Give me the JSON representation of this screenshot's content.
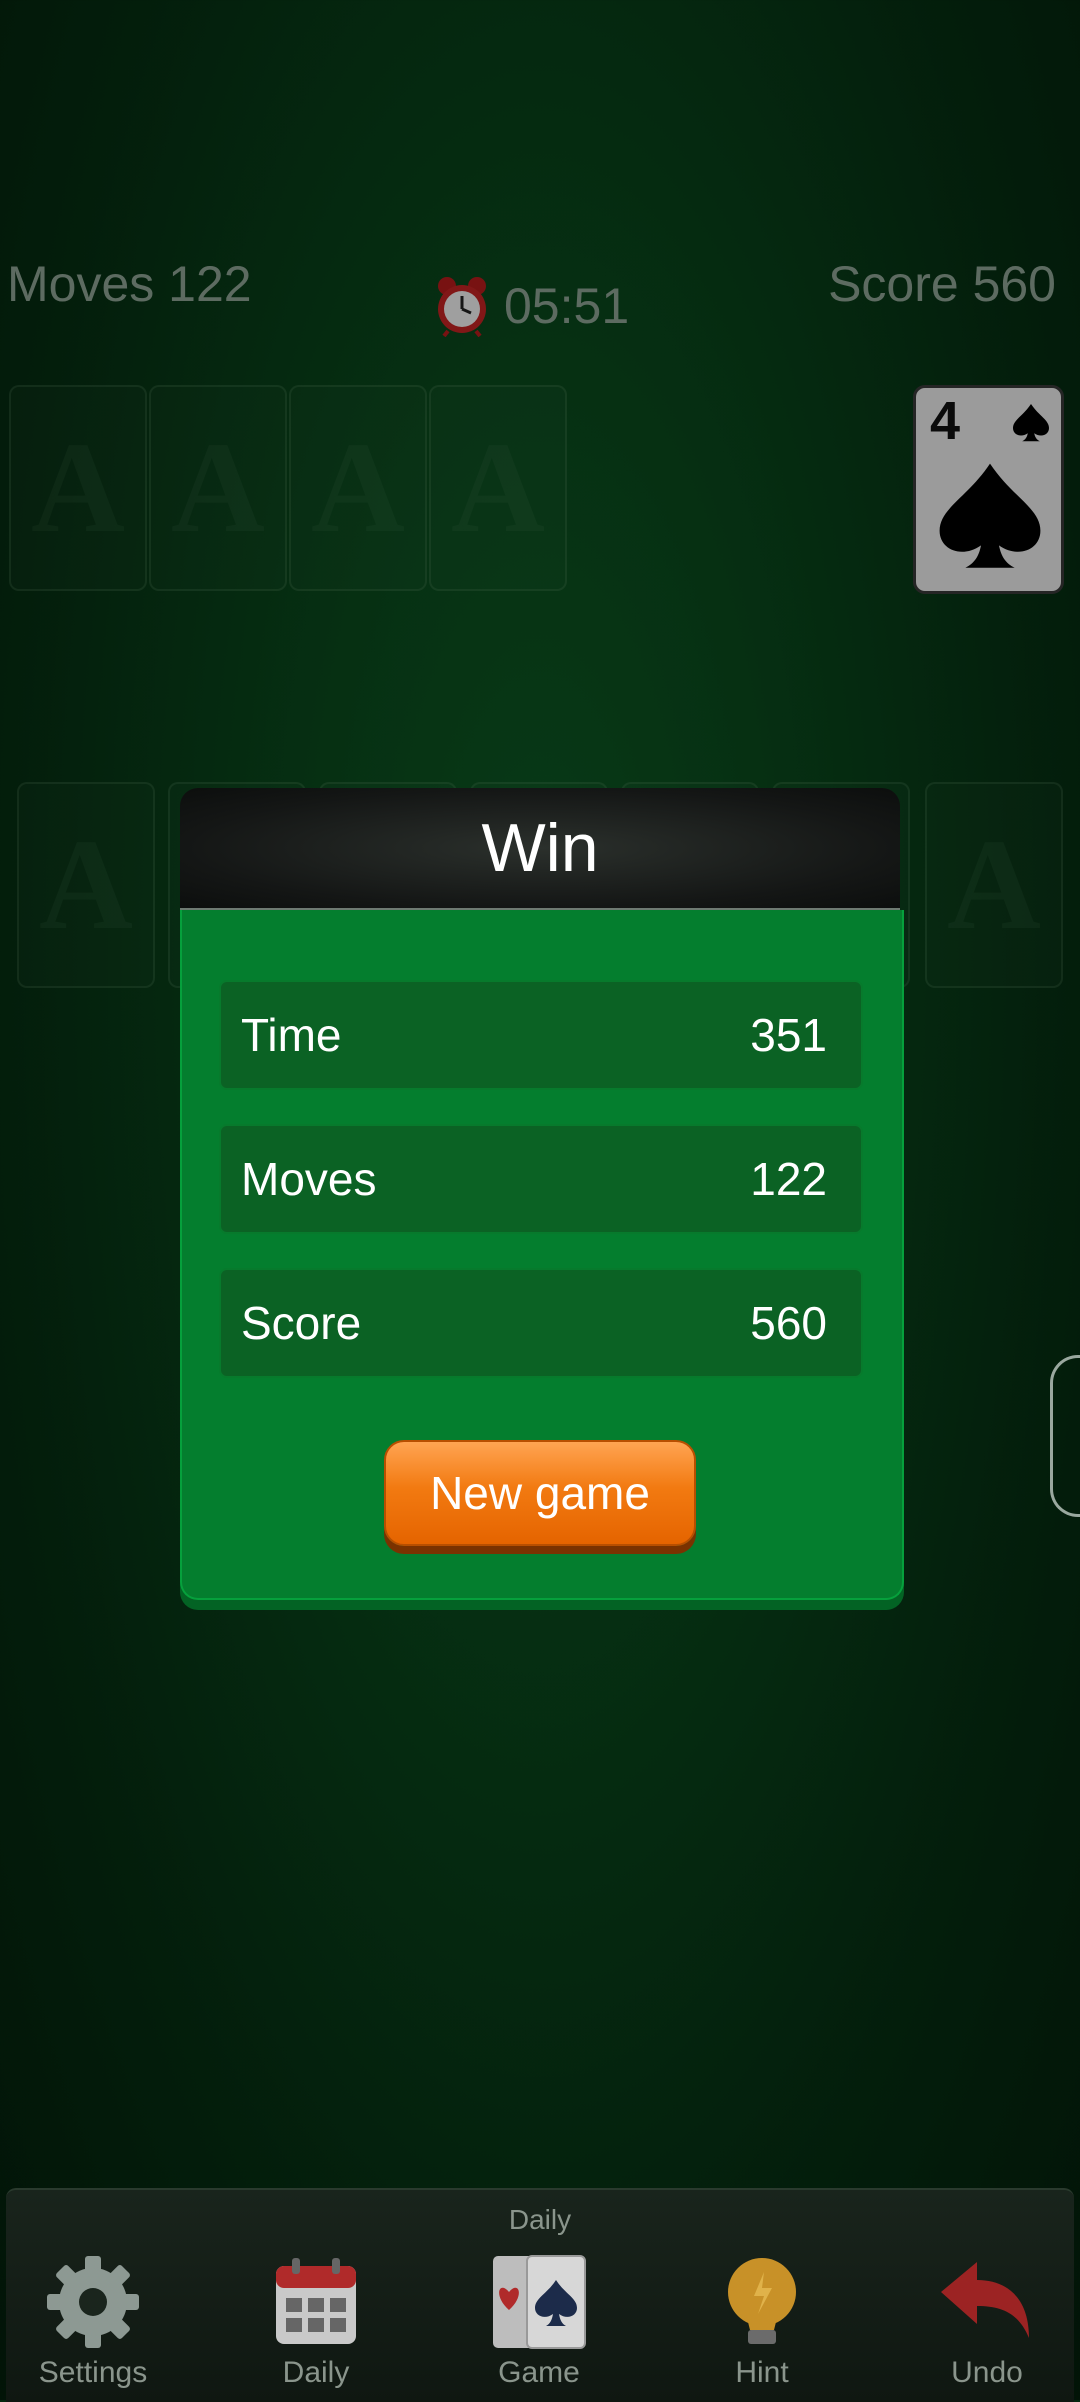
{
  "hud": {
    "moves": "Moves 122",
    "timer": "05:51",
    "score": "Score 560"
  },
  "slot_letter": "A",
  "stock_card": {
    "rank": "4",
    "suit": "spade"
  },
  "dialog": {
    "title": "Win",
    "stats": [
      {
        "label": "Time",
        "value": "351"
      },
      {
        "label": "Moves",
        "value": "122"
      },
      {
        "label": "Score",
        "value": "560"
      }
    ],
    "button": "New game"
  },
  "bottom_bar": {
    "caption": "Daily",
    "items": [
      {
        "label": "Settings",
        "icon": "gear-icon"
      },
      {
        "label": "Daily",
        "icon": "calendar-icon"
      },
      {
        "label": "Game",
        "icon": "cards-icon"
      },
      {
        "label": "Hint",
        "icon": "lightbulb-icon"
      },
      {
        "label": "Undo",
        "icon": "undo-arrow-icon"
      }
    ]
  },
  "colors": {
    "felt": "#0a4a1d",
    "dialog_body": "#047e2e",
    "stat_row": "#0b6224",
    "button": "#f27a11"
  }
}
